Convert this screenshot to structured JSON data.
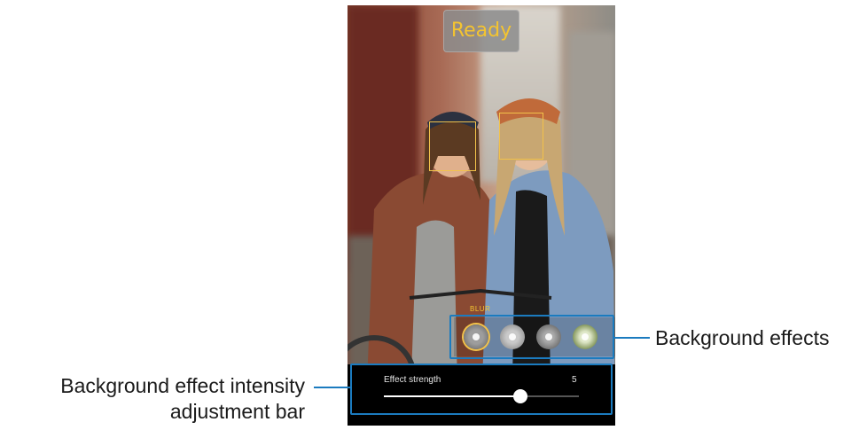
{
  "camera": {
    "ready_label": "Ready",
    "effect_label": "BLUR",
    "effects": [
      "blur",
      "big-circle",
      "color-point",
      "zoom"
    ],
    "selected_effect": "blur",
    "strength": {
      "label": "Effect strength",
      "value": "5",
      "fraction": 0.7
    }
  },
  "callouts": {
    "effects_label": "Background effects",
    "intensity_line1": "Background effect intensity",
    "intensity_line2": "adjustment bar"
  },
  "colors": {
    "callout": "#1b7bbf",
    "accent": "#f4c430"
  }
}
